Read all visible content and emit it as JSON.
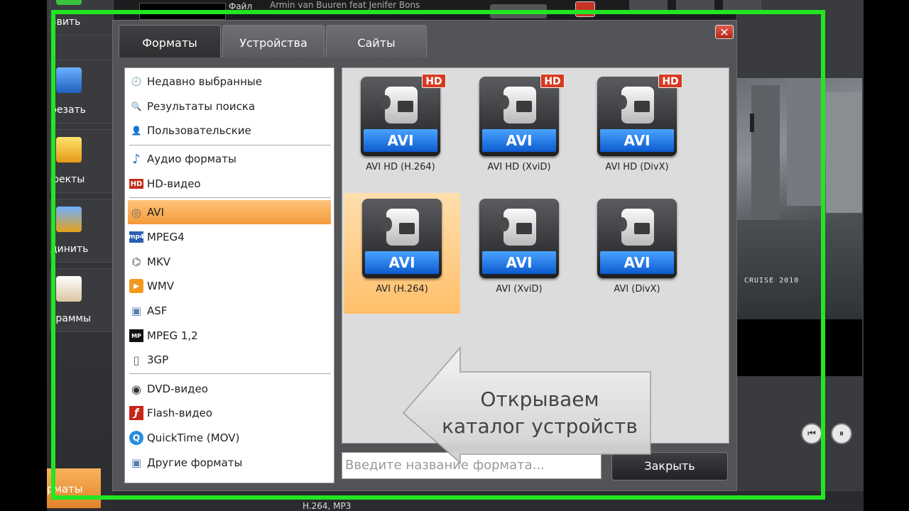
{
  "background": {
    "left_panel": [
      {
        "label": "авить",
        "icon": "add-icon"
      },
      {
        "label": "резать",
        "icon": "scissors-icon"
      },
      {
        "label": "фекты",
        "icon": "magic-wand-icon"
      },
      {
        "label": "динить",
        "icon": "join-icon"
      },
      {
        "label": "граммы",
        "icon": "slideshow-icon"
      }
    ],
    "left_formats_label": "рматы",
    "top_title": "Armin van Buuren feat Jenifer Bons",
    "top_file_label": "Файл",
    "video_overlay_text": "CRUISE 2010",
    "bottom_text": "H.264, MP3",
    "player_buttons": [
      "⏮",
      "⏸"
    ]
  },
  "dialog": {
    "tabs": [
      {
        "label": "Форматы",
        "active": true
      },
      {
        "label": "Устройства",
        "active": false
      },
      {
        "label": "Сайты",
        "active": false
      }
    ],
    "close_x": "✕",
    "categories": [
      {
        "label": "Недавно выбранные",
        "icon": "recent-icon",
        "icon_text": "🕘"
      },
      {
        "label": "Результаты поиска",
        "icon": "search-icon",
        "icon_text": "🔍"
      },
      {
        "label": "Пользовательские",
        "icon": "user-icon",
        "icon_text": "👤"
      },
      {
        "label": "Аудио форматы",
        "icon": "music-note-icon",
        "icon_text": "♪"
      },
      {
        "label": "HD-видео",
        "icon": "hd-icon",
        "icon_text": "HD"
      },
      {
        "label": "AVI",
        "icon": "film-reel-icon",
        "icon_text": "◎",
        "selected": true
      },
      {
        "label": "MPEG4",
        "icon": "mp4-icon",
        "icon_text": "mp4"
      },
      {
        "label": "MKV",
        "icon": "mkv-icon",
        "icon_text": "⌬"
      },
      {
        "label": "WMV",
        "icon": "wmv-play-icon",
        "icon_text": "▶"
      },
      {
        "label": "ASF",
        "icon": "asf-icon",
        "icon_text": "▣"
      },
      {
        "label": "MPEG 1,2",
        "icon": "mpeg-org-icon",
        "icon_text": "MP"
      },
      {
        "label": "3GP",
        "icon": "phone-icon",
        "icon_text": "▯"
      },
      {
        "label": "DVD-видео",
        "icon": "dvd-icon",
        "icon_text": "◉"
      },
      {
        "label": "Flash-видео",
        "icon": "flash-icon",
        "icon_text": "ƒ"
      },
      {
        "label": "QuickTime (MOV)",
        "icon": "quicktime-icon",
        "icon_text": "Q"
      },
      {
        "label": "Другие форматы",
        "icon": "other-formats-icon",
        "icon_text": "▣"
      }
    ],
    "formats": [
      {
        "badge": "AVI",
        "hd": "HD",
        "caption": "AVI HD (H.264)"
      },
      {
        "badge": "AVI",
        "hd": "HD",
        "caption": "AVI HD (XviD)"
      },
      {
        "badge": "AVI",
        "hd": "HD",
        "caption": "AVI HD (DivX)"
      },
      {
        "badge": "AVI",
        "caption": "AVI (H.264)",
        "selected": true
      },
      {
        "badge": "AVI",
        "caption": "AVI (XviD)"
      },
      {
        "badge": "AVI",
        "caption": "AVI (DivX)"
      }
    ],
    "search_placeholder": "Введите название формата...",
    "close_button": "Закрыть"
  },
  "annotation": {
    "line1": "Открываем",
    "line2": "каталог устройств"
  },
  "colors": {
    "frame": "#22e622",
    "selection": "#f39a3a",
    "avi_badge": "#0d5bd0",
    "hd_badge": "#d63a20"
  }
}
